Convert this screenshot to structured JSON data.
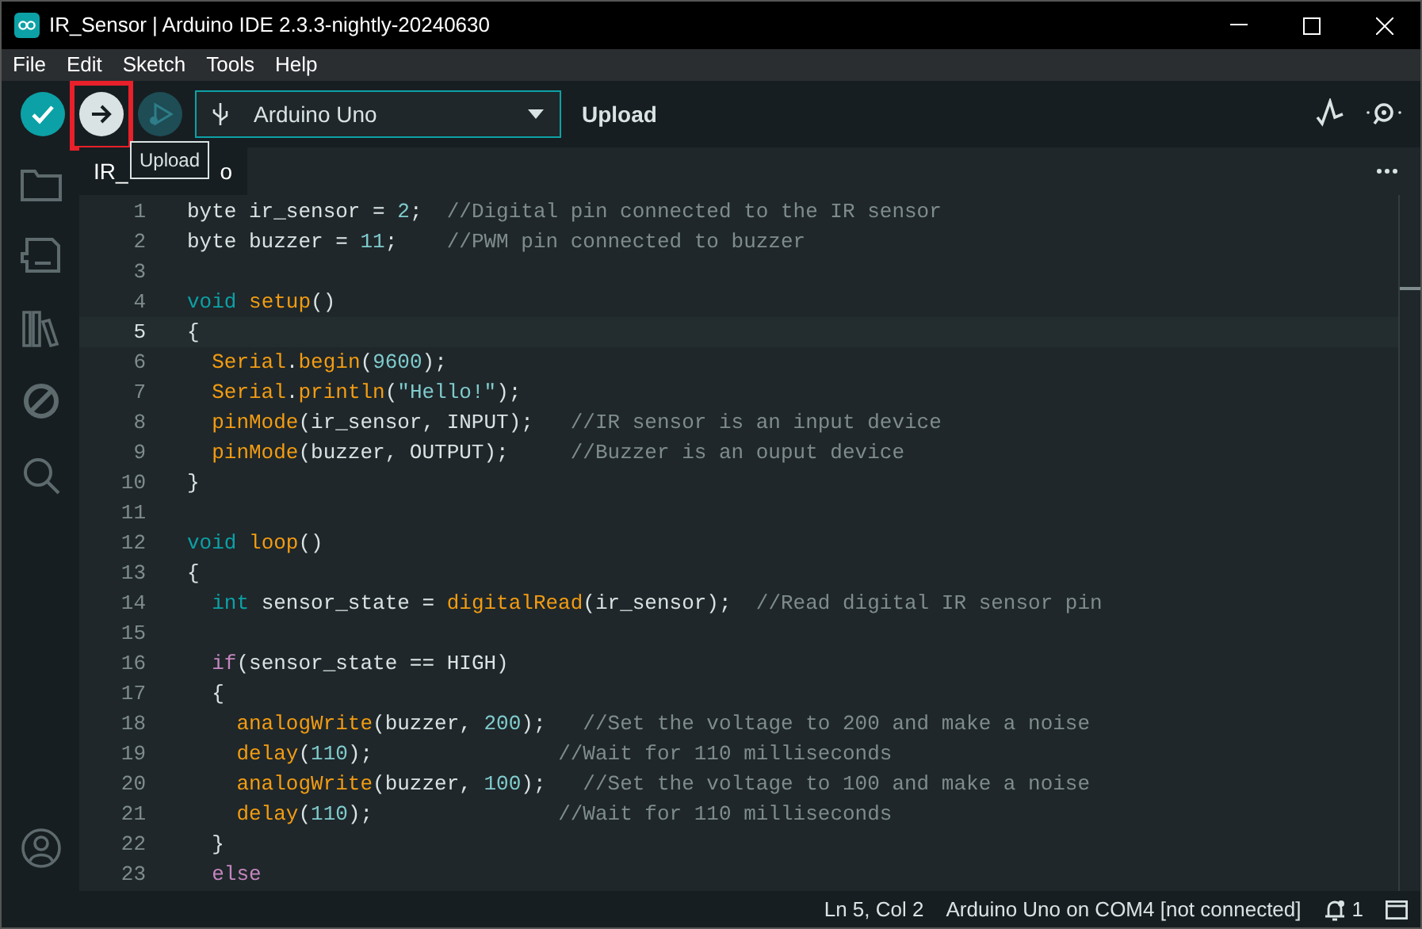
{
  "window": {
    "title": "IR_Sensor | Arduino IDE 2.3.3-nightly-20240630"
  },
  "menu": [
    "File",
    "Edit",
    "Sketch",
    "Tools",
    "Help"
  ],
  "toolbar": {
    "buttons": [
      {
        "kind": "verify"
      },
      {
        "kind": "upload",
        "highlighted": true
      },
      {
        "kind": "debug"
      }
    ],
    "board": "Arduino Uno",
    "action_label": "Upload",
    "tooltip": "Upload"
  },
  "tab": {
    "label_start": "IR_",
    "label_end": "o"
  },
  "code": {
    "lines": [
      {
        "number": "1",
        "current": false,
        "tokens": [
          {
            "kind": "plain",
            "text": "byte ir_sensor = "
          },
          {
            "kind": "num",
            "text": "2"
          },
          {
            "kind": "plain",
            "text": ";  "
          },
          {
            "kind": "comment",
            "text": "//Digital pin connected to the IR sensor"
          }
        ]
      },
      {
        "number": "2",
        "current": false,
        "tokens": [
          {
            "kind": "plain",
            "text": "byte buzzer = "
          },
          {
            "kind": "num",
            "text": "11"
          },
          {
            "kind": "plain",
            "text": ";    "
          },
          {
            "kind": "comment",
            "text": "//PWM pin connected to buzzer"
          }
        ]
      },
      {
        "number": "3",
        "current": false
      },
      {
        "number": "4",
        "current": false,
        "tokens": [
          {
            "kind": "kw",
            "text": "void"
          },
          {
            "kind": "fn",
            "text": " setup"
          },
          {
            "kind": "plain",
            "text": "()"
          }
        ]
      },
      {
        "number": "5",
        "current": true,
        "tokens": [
          {
            "kind": "plain",
            "text": "{"
          }
        ]
      },
      {
        "number": "6",
        "current": false,
        "tokens": [
          {
            "kind": "fn",
            "text": "  Serial"
          },
          {
            "kind": "plain",
            "text": "."
          },
          {
            "kind": "fn",
            "text": "begin"
          },
          {
            "kind": "plain",
            "text": "("
          },
          {
            "kind": "num",
            "text": "9600"
          },
          {
            "kind": "plain",
            "text": ");"
          }
        ]
      },
      {
        "number": "7",
        "current": false,
        "tokens": [
          {
            "kind": "fn",
            "text": "  Serial"
          },
          {
            "kind": "plain",
            "text": "."
          },
          {
            "kind": "fn",
            "text": "println"
          },
          {
            "kind": "plain",
            "text": "("
          },
          {
            "kind": "str",
            "text": "\"Hello!\""
          },
          {
            "kind": "plain",
            "text": ");"
          }
        ]
      },
      {
        "number": "8",
        "current": false,
        "tokens": [
          {
            "kind": "fn",
            "text": "  pinMode"
          },
          {
            "kind": "plain",
            "text": "(ir_sensor, INPUT);   "
          },
          {
            "kind": "comment",
            "text": "//IR sensor is an input device"
          }
        ]
      },
      {
        "number": "9",
        "current": false,
        "tokens": [
          {
            "kind": "fn",
            "text": "  pinMode"
          },
          {
            "kind": "plain",
            "text": "(buzzer, OUTPUT);     "
          },
          {
            "kind": "comment",
            "text": "//Buzzer is an ouput device"
          }
        ]
      },
      {
        "number": "10",
        "current": false,
        "tokens": [
          {
            "kind": "plain",
            "text": "}"
          }
        ]
      },
      {
        "number": "11",
        "current": false
      },
      {
        "number": "12",
        "current": false,
        "tokens": [
          {
            "kind": "kw",
            "text": "void"
          },
          {
            "kind": "fn",
            "text": " loop"
          },
          {
            "kind": "plain",
            "text": "()"
          }
        ]
      },
      {
        "number": "13",
        "current": false,
        "tokens": [
          {
            "kind": "plain",
            "text": "{"
          }
        ]
      },
      {
        "number": "14",
        "current": false,
        "tokens": [
          {
            "kind": "kw",
            "text": "  int"
          },
          {
            "kind": "plain",
            "text": " sensor_state = "
          },
          {
            "kind": "fn",
            "text": "digitalRead"
          },
          {
            "kind": "plain",
            "text": "(ir_sensor);  "
          },
          {
            "kind": "comment",
            "text": "//Read digital IR sensor pin"
          }
        ]
      },
      {
        "number": "15",
        "current": false
      },
      {
        "number": "16",
        "current": false,
        "tokens": [
          {
            "kind": "ctl",
            "text": "  if"
          },
          {
            "kind": "plain",
            "text": "(sensor_state == HIGH)"
          }
        ]
      },
      {
        "number": "17",
        "current": false,
        "tokens": [
          {
            "kind": "plain",
            "text": "  {"
          }
        ]
      },
      {
        "number": "18",
        "current": false,
        "tokens": [
          {
            "kind": "fn",
            "text": "    analogWrite"
          },
          {
            "kind": "plain",
            "text": "(buzzer, "
          },
          {
            "kind": "num",
            "text": "200"
          },
          {
            "kind": "plain",
            "text": ");   "
          },
          {
            "kind": "comment",
            "text": "//Set the voltage to 200 and make a noise"
          }
        ]
      },
      {
        "number": "19",
        "current": false,
        "tokens": [
          {
            "kind": "fn",
            "text": "    delay"
          },
          {
            "kind": "plain",
            "text": "("
          },
          {
            "kind": "num",
            "text": "110"
          },
          {
            "kind": "plain",
            "text": ");               "
          },
          {
            "kind": "comment",
            "text": "//Wait for 110 milliseconds"
          }
        ]
      },
      {
        "number": "20",
        "current": false,
        "tokens": [
          {
            "kind": "fn",
            "text": "    analogWrite"
          },
          {
            "kind": "plain",
            "text": "(buzzer, "
          },
          {
            "kind": "num",
            "text": "100"
          },
          {
            "kind": "plain",
            "text": ");   "
          },
          {
            "kind": "comment",
            "text": "//Set the voltage to 100 and make a noise"
          }
        ]
      },
      {
        "number": "21",
        "current": false,
        "tokens": [
          {
            "kind": "fn",
            "text": "    delay"
          },
          {
            "kind": "plain",
            "text": "("
          },
          {
            "kind": "num",
            "text": "110"
          },
          {
            "kind": "plain",
            "text": ");               "
          },
          {
            "kind": "comment",
            "text": "//Wait for 110 milliseconds"
          }
        ]
      },
      {
        "number": "22",
        "current": false,
        "tokens": [
          {
            "kind": "plain",
            "text": "  }"
          }
        ]
      },
      {
        "number": "23",
        "current": false,
        "tokens": [
          {
            "kind": "ctl",
            "text": "  else"
          }
        ]
      }
    ]
  },
  "status_bar": {
    "position": "Ln 5, Col 2",
    "board": "Arduino Uno on COM4 [not connected]",
    "notifications": "1"
  }
}
